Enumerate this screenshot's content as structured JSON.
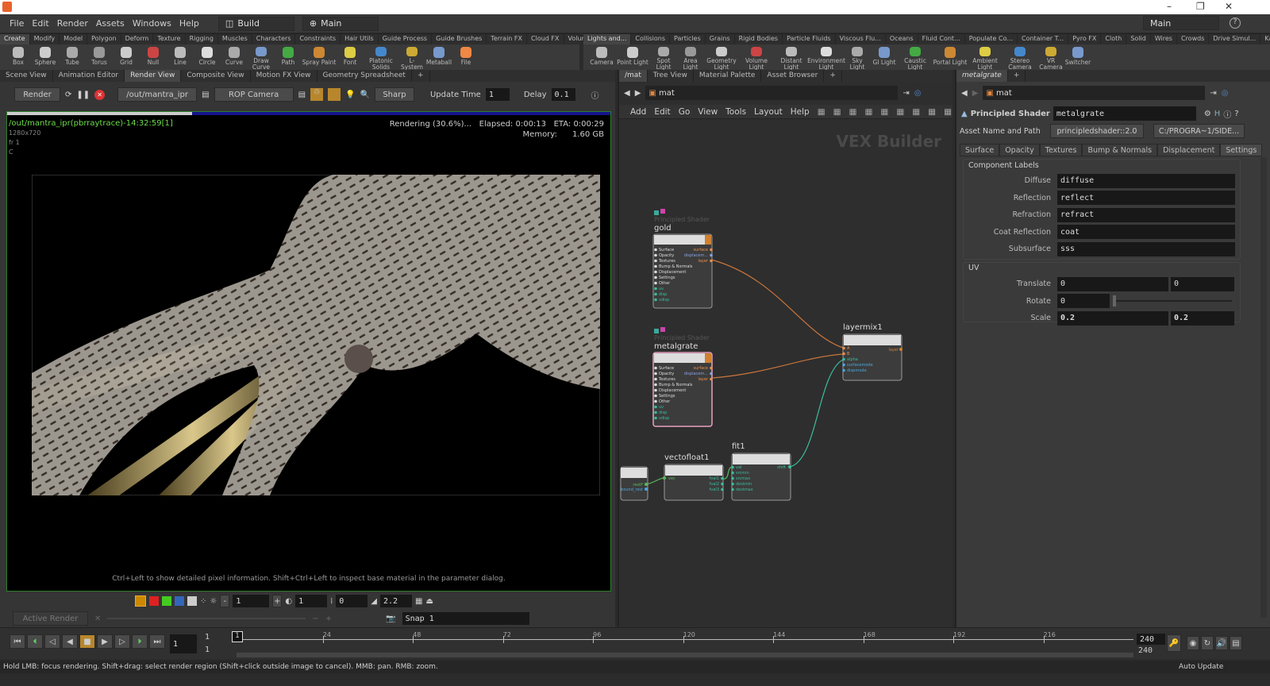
{
  "menu": {
    "items": [
      "File",
      "Edit",
      "Render",
      "Assets",
      "Windows",
      "Help"
    ],
    "desktop": "Build",
    "context": "Main",
    "right_desktop": "Main"
  },
  "shelf_left": {
    "tabs": [
      "Create",
      "Modify",
      "Model",
      "Polygon",
      "Deform",
      "Texture",
      "Rigging",
      "Muscles",
      "Characters",
      "Constraints",
      "Hair Utils",
      "Guide Process",
      "Guide Brushes",
      "Terrain FX",
      "Cloud FX",
      "Volume"
    ],
    "tools": [
      "Box",
      "Sphere",
      "Tube",
      "Torus",
      "Grid",
      "Null",
      "Line",
      "Circle",
      "Curve",
      "Draw Curve",
      "Path",
      "Spray Paint",
      "Font",
      "Platonic Solids",
      "L-System",
      "Metaball",
      "File"
    ]
  },
  "shelf_right": {
    "tabs": [
      "Lights and...",
      "Collisions",
      "Particles",
      "Grains",
      "Rigid Bodies",
      "Particle Fluids",
      "Viscous Flu...",
      "Oceans",
      "Fluid Cont...",
      "Populate Co...",
      "Container T...",
      "Pyro FX",
      "Cloth",
      "Solid",
      "Wires",
      "Crowds",
      "Drive Simul...",
      "Kai"
    ],
    "tools": [
      "Camera",
      "Point Light",
      "Spot Light",
      "Area Light",
      "Geometry Light",
      "Volume Light",
      "Distant Light",
      "Environment Light",
      "Sky Light",
      "GI Light",
      "Caustic Light",
      "Portal Light",
      "Ambient Light",
      "Stereo Camera",
      "VR Camera",
      "Switcher"
    ]
  },
  "left_pane": {
    "tabs": [
      "Scene View",
      "Animation Editor",
      "Render View",
      "Composite View",
      "Motion FX View",
      "Geometry Spreadsheet"
    ],
    "render_button": "Render",
    "rop": "/out/mantra_ipr",
    "camera": "ROP Camera",
    "filter": "Sharp",
    "update_time_label": "Update Time",
    "update_time": "1",
    "delay_label": "Delay",
    "delay": "0.1",
    "progress": 0.306,
    "overlay": {
      "path": "/out/mantra_ipr(pbrraytrace)-14:32:59[1]",
      "res": "1280x720",
      "frame": "fr 1",
      "channel": "C",
      "status": "Rendering (30.6%)...",
      "elapsed": "Elapsed: 0:00:13",
      "eta": "ETA: 0:00:29",
      "memory_label": "Memory:",
      "memory": "1.60 GB"
    },
    "hint": "Ctrl+Left to show detailed pixel information. Shift+Ctrl+Left to inspect base material in the parameter dialog.",
    "bottom": {
      "exposure": "1",
      "gamma_val": "1",
      "offset": "0",
      "gamma": "2.2",
      "active_render": "Active Render",
      "snap": "Snap 1"
    }
  },
  "network": {
    "tabs": [
      "/mat",
      "Tree View",
      "Material Palette",
      "Asset Browser"
    ],
    "path": "mat",
    "menu": [
      "Add",
      "Edit",
      "Go",
      "View",
      "Tools",
      "Layout",
      "Help"
    ],
    "watermark": "VEX Builder",
    "nodes": {
      "gold": {
        "type": "Principled Shader",
        "name": "gold",
        "inputs": [
          "Surface",
          "Opacity",
          "Textures",
          "Bump & Normals",
          "Displacement",
          "Settings",
          "Other",
          "uv",
          "disp",
          "vdisp"
        ],
        "outputs": [
          "surface",
          "displacem...",
          "layer"
        ]
      },
      "metalgrate": {
        "type": "Principled Shader",
        "name": "metalgrate",
        "inputs": [
          "Surface",
          "Opacity",
          "Textures",
          "Bump & Normals",
          "Displacement",
          "Settings",
          "Other",
          "uv",
          "disp",
          "vdisp"
        ],
        "outputs": [
          "surface",
          "displacem...",
          "layer"
        ]
      },
      "layermix": {
        "name": "layermix1",
        "inputs": [
          "A",
          "B",
          "alpha",
          "surfacemode",
          "dispmode"
        ],
        "output": "layer"
      },
      "vectofloat": {
        "name": "vectofloat1",
        "input": "vec",
        "outputs": [
          "fval1",
          "fval2",
          "fval3"
        ]
      },
      "fit": {
        "name": "fit1",
        "inputs": [
          "val",
          "srcmin",
          "srcmax",
          "destmin",
          "destmax"
        ],
        "output": "shift"
      },
      "partial": {
        "outputs": [
          "restP",
          "bound_rest"
        ]
      }
    }
  },
  "params": {
    "tab": "metalgrate",
    "path": "mat",
    "node_type": "Principled Shader",
    "node_name": "metalgrate",
    "asset_label": "Asset Name and Path",
    "asset": "principledshader::2.0",
    "asset_path": "C:/PROGRA~1/SIDE...",
    "tabs": [
      "Surface",
      "Opacity",
      "Textures",
      "Bump & Normals",
      "Displacement",
      "Settings"
    ],
    "component_labels": {
      "title": "Component Labels",
      "rows": [
        {
          "label": "Diffuse",
          "value": "diffuse"
        },
        {
          "label": "Reflection",
          "value": "reflect"
        },
        {
          "label": "Refraction",
          "value": "refract"
        },
        {
          "label": "Coat Reflection",
          "value": "coat"
        },
        {
          "label": "Subsurface",
          "value": "sss"
        }
      ]
    },
    "uv": {
      "title": "UV",
      "translate_label": "Translate",
      "translate": [
        "0",
        "0"
      ],
      "rotate_label": "Rotate",
      "rotate": "0",
      "scale_label": "Scale",
      "scale": [
        "0.2",
        "0.2"
      ]
    }
  },
  "timeline": {
    "frame": "1",
    "start": "1",
    "start2": "1",
    "ticks": [
      "24",
      "48",
      "72",
      "96",
      "120",
      "144",
      "168",
      "192",
      "216"
    ],
    "current_marker": "1",
    "end": "240",
    "end2": "240"
  },
  "status": {
    "text": "Hold LMB: focus rendering. Shift+drag: select render region (Shift+click outside image to cancel). MMB: pan. RMB: zoom.",
    "auto_update": "Auto Update"
  }
}
